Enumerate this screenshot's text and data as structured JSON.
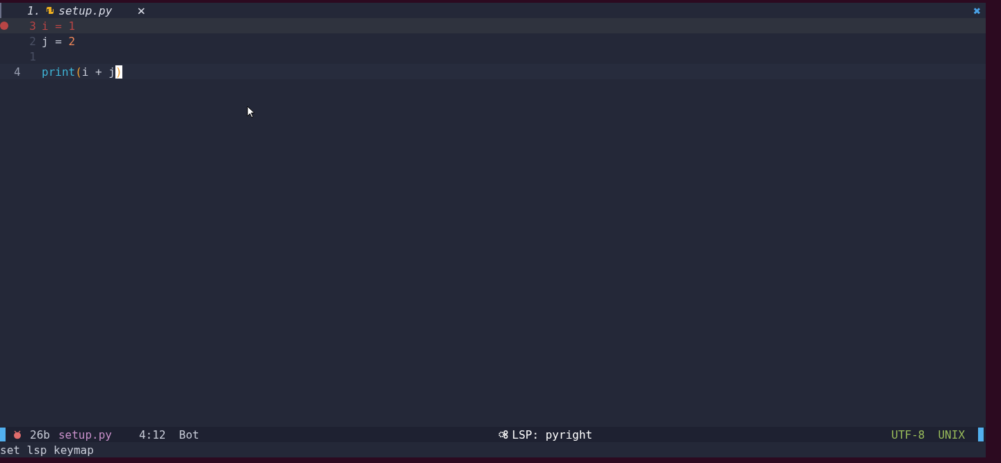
{
  "tabs": [
    {
      "index": "1.",
      "label": "setup.py",
      "selected": true,
      "close": "×"
    }
  ],
  "close_all": "✖",
  "lines": [
    {
      "number": "3",
      "kind": "breakpoint",
      "tokens": [
        {
          "text": "i = 1",
          "kind": "error"
        }
      ]
    },
    {
      "number": "2",
      "kind": "plain",
      "tokens": [
        {
          "text": "j = ",
          "kind": "text"
        },
        {
          "text": "2",
          "kind": "number"
        }
      ]
    },
    {
      "number": "1",
      "kind": "plain"
    },
    {
      "number": "4",
      "kind": "cursor",
      "tokens": [
        {
          "text": "print",
          "kind": "function"
        },
        {
          "text": "(",
          "kind": "paren"
        },
        {
          "text": "i + j",
          "kind": "text"
        },
        {
          "text": ")",
          "kind": "cursor"
        }
      ]
    }
  ],
  "status_bar": {
    "size": "26b",
    "file": "setup.py",
    "position": "4:12",
    "scroll": "Bot",
    "lsp": "LSP: pyright",
    "encoding": "UTF-8",
    "format": "UNIX"
  },
  "command_line": "set lsp keymap"
}
